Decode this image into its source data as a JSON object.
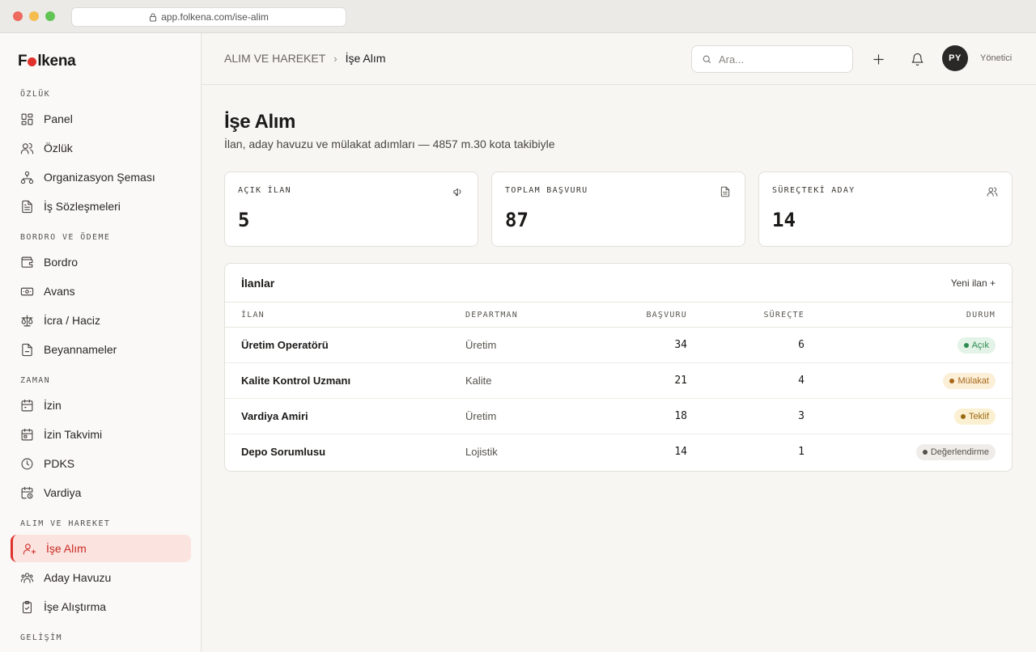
{
  "browser": {
    "url": "app.folkena.com/ise-alim"
  },
  "brand": {
    "name_before": "F",
    "name_after": "lkena"
  },
  "sidebar": {
    "sections": [
      {
        "title": "ÖZLÜK",
        "items": [
          {
            "label": "Panel",
            "icon": "grid-icon"
          },
          {
            "label": "Özlük",
            "icon": "users-icon"
          },
          {
            "label": "Organizasyon Şeması",
            "icon": "org-chart-icon"
          },
          {
            "label": "İş Sözleşmeleri",
            "icon": "document-icon"
          }
        ]
      },
      {
        "title": "BORDRO VE ÖDEME",
        "items": [
          {
            "label": "Bordro",
            "icon": "wallet-icon"
          },
          {
            "label": "Avans",
            "icon": "cash-icon"
          },
          {
            "label": "İcra / Haciz",
            "icon": "scale-icon"
          },
          {
            "label": "Beyannameler",
            "icon": "file-icon"
          }
        ]
      },
      {
        "title": "ZAMAN",
        "items": [
          {
            "label": "İzin",
            "icon": "calendar-icon"
          },
          {
            "label": "İzin Takvimi",
            "icon": "calendar-grid-icon"
          },
          {
            "label": "PDKS",
            "icon": "clock-icon"
          },
          {
            "label": "Vardiya",
            "icon": "calendar-clock-icon"
          }
        ]
      },
      {
        "title": "ALIM VE HAREKET",
        "items": [
          {
            "label": "İşe Alım",
            "icon": "user-plus-icon",
            "active": true
          },
          {
            "label": "Aday Havuzu",
            "icon": "people-group-icon"
          },
          {
            "label": "İşe Alıştırma",
            "icon": "clipboard-check-icon"
          }
        ]
      },
      {
        "title": "GELİŞİM",
        "items": []
      }
    ]
  },
  "header": {
    "breadcrumb": [
      "ALIM VE HAREKET",
      "İşe Alım"
    ],
    "search_placeholder": "Ara...",
    "avatar_initials": "PY",
    "role": "Yönetici"
  },
  "page": {
    "title": "İşe Alım",
    "subtitle": "İlan, aday havuzu ve mülakat adımları — 4857 m.30 kota takibiyle"
  },
  "stats": [
    {
      "label": "AÇIK İLAN",
      "value": "5",
      "icon": "megaphone-icon"
    },
    {
      "label": "TOPLAM BAŞVURU",
      "value": "87",
      "icon": "document-icon"
    },
    {
      "label": "SÜREÇTEKİ ADAY",
      "value": "14",
      "icon": "users-icon"
    }
  ],
  "listings": {
    "title": "İlanlar",
    "action": "Yeni ilan +",
    "columns": [
      "İLAN",
      "DEPARTMAN",
      "BAŞVURU",
      "SÜREÇTE",
      "DURUM"
    ],
    "rows": [
      {
        "name": "Üretim Operatörü",
        "dept": "Üretim",
        "applications": "34",
        "in_process": "6",
        "status": "Açık",
        "status_color": "#2e8a4e",
        "status_bg": "#e3f3e8"
      },
      {
        "name": "Kalite Kontrol Uzmanı",
        "dept": "Kalite",
        "applications": "21",
        "in_process": "4",
        "status": "Mülakat",
        "status_color": "#a8671a",
        "status_bg": "#fcefd8"
      },
      {
        "name": "Vardiya Amiri",
        "dept": "Üretim",
        "applications": "18",
        "in_process": "3",
        "status": "Teklif",
        "status_color": "#9a6a12",
        "status_bg": "#fcf0d2"
      },
      {
        "name": "Depo Sorumlusu",
        "dept": "Lojistik",
        "applications": "14",
        "in_process": "1",
        "status": "Değerlendirme",
        "status_color": "#555049",
        "status_bg": "#efede9"
      }
    ]
  }
}
